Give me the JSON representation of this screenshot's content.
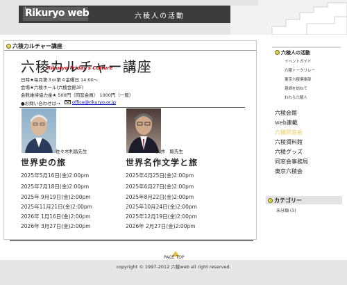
{
  "header": {
    "logo": "Rikuryo web",
    "logo_mark": "i",
    "title": "六稜人の活動"
  },
  "main": {
    "section_title": "六稜カルチャー講座",
    "course_title": "六稜カルチャー講座",
    "course_subtitle": "Rikuryo Friday's Culture",
    "info": [
      "日時★毎月第３or第４金曜日 14:00〜",
      "会場★六稜ホール(六稜会館3F)",
      "会館維持協力金★ 500円（同窓会員） 1000円（一般）",
      "●お問い合わせは→"
    ],
    "email": "office@rikuryo.or.jp",
    "lecturers": [
      {
        "caption": "佐々木利昌先生",
        "lecture": "世界史の旅",
        "dates": [
          "2025年5月16日(金)2:00pm",
          "2025年7月18日(金)2:00pm",
          "2025年 9月19日(金)2:00pm",
          "2025年11月21日(金)2:00pm",
          "2026年 1月16日(金)2:00pm",
          "2026年 3月27日(金)2:00pm"
        ]
      },
      {
        "caption": "久井　毅先生",
        "lecture": "世界名作文学と旅",
        "dates": [
          "2025年4月25日(金)2:00pm",
          "2025年6月27日(金)2:00pm",
          "2025年8月22日(金)2:00pm",
          "2025年10月24日(金)2:00pm",
          "2025年12月19日(金)2:00pm",
          "2026年 2月27日(金)2:00pm"
        ]
      }
    ]
  },
  "sidebar": {
    "heading": "六稜人の活動",
    "sub_items": [
      "イベントガイド",
      "六稜トークリレー",
      "東京六稜倶楽部",
      "恩師を訪ねて",
      "われら六稜人"
    ],
    "links": [
      "六稜会館",
      "web連載",
      "六稜同窓会",
      "六稜資料館",
      "六稜グッズ",
      "同窓会事務局",
      "東京六稜会"
    ],
    "active_link": "六稜同窓会",
    "category_title": "カテゴリー",
    "category_item": "未分類 (3)"
  },
  "footer": {
    "pagetop": "PAGE TOP",
    "copyright": "copyright © 1997-2012 六稜web all right reserved."
  },
  "colors": {
    "accent": "#e8d64a",
    "header_bg": "#e6e6e6",
    "header_bar": "#3b3b3b",
    "subtitle_red": "#c0141a",
    "link_blue": "#0000cc"
  }
}
